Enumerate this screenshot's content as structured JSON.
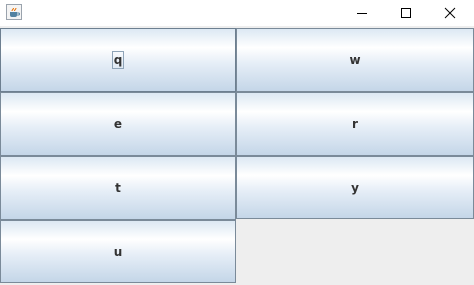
{
  "window": {
    "icon": "java-coffee-cup-icon",
    "controls": {
      "minimize": "minimize-icon",
      "maximize": "maximize-icon",
      "close": "close-icon"
    }
  },
  "buttons": [
    {
      "label": "q",
      "focused": true
    },
    {
      "label": "w",
      "focused": false
    },
    {
      "label": "e",
      "focused": false
    },
    {
      "label": "r",
      "focused": false
    },
    {
      "label": "t",
      "focused": false
    },
    {
      "label": "y",
      "focused": false
    },
    {
      "label": "u",
      "focused": false
    }
  ],
  "colors": {
    "button_border": "#7a8a99",
    "button_gradient_top": "#ffffff",
    "button_gradient_bottom": "#c4d6e8",
    "panel_background": "#eeeeee"
  }
}
